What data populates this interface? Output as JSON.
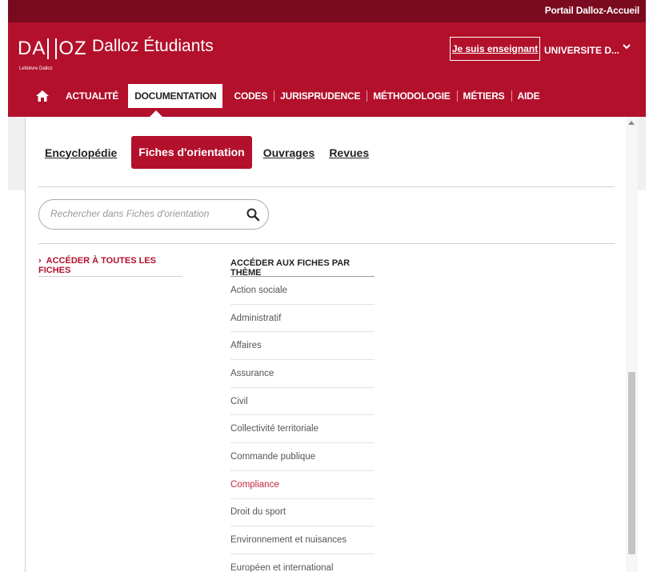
{
  "top_bar": {
    "portal_link": "Portail Dalloz-Accueil"
  },
  "header": {
    "logo_left": "DA",
    "logo_right": "OZ",
    "logo_sub": "Lefebvre Dalloz",
    "site_name": "Dalloz Étudiants",
    "teacher_button": "Je suis enseignant",
    "university_label": "UNIVERSITE D..."
  },
  "nav": {
    "items": [
      "ACTUALITÉ",
      "DOCUMENTATION",
      "CODES",
      "JURISPRUDENCE",
      "MÉTHODOLOGIE",
      "MÉTIERS",
      "AIDE"
    ],
    "active": "DOCUMENTATION"
  },
  "tabs": {
    "items": [
      "Encyclopédie",
      "Fiches d'orientation",
      "Ouvrages",
      "Revues"
    ],
    "active": "Fiches d'orientation"
  },
  "search": {
    "placeholder": "Rechercher dans Fiches d'orientation"
  },
  "left_links": {
    "all_sheets": "ACCÉDER À TOUTES LES FICHES"
  },
  "themes": {
    "heading": "ACCÉDER AUX FICHES PAR THÈME",
    "items": [
      "Action sociale",
      "Administratif",
      "Affaires",
      "Assurance",
      "Civil",
      "Collectivité territoriale",
      "Commande publique",
      "Compliance",
      "Droit du sport",
      "Environnement et nuisances",
      "Européen et international"
    ],
    "highlighted": "Compliance"
  },
  "colors": {
    "brand": "#b3102c",
    "brand_dark": "#7a0a1e",
    "highlight_text": "#c4223c"
  }
}
